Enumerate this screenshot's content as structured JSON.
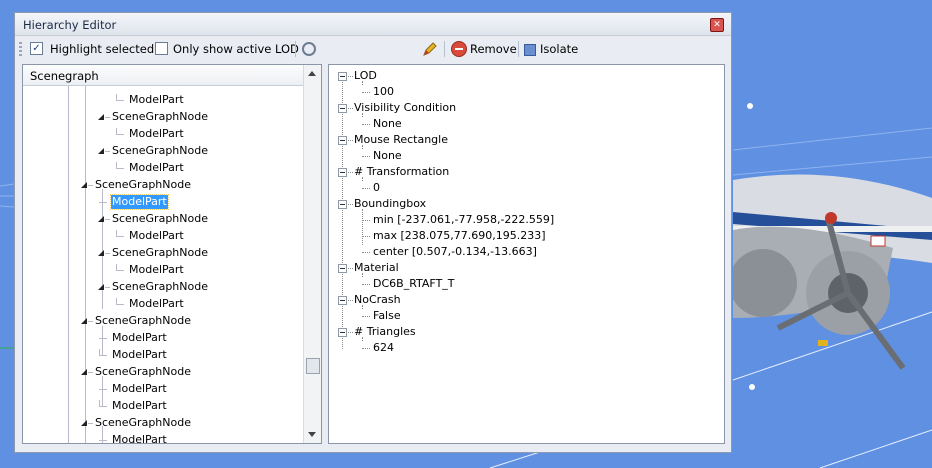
{
  "window": {
    "title": "Hierarchy Editor"
  },
  "toolbar": {
    "highlight_label": "Highlight selected",
    "highlight_checked": true,
    "lod_label": "Only show active LOD",
    "lod_checked": false,
    "remove_label": "Remove",
    "isolate_label": "Isolate"
  },
  "scenegraph": {
    "header": "Scenegraph",
    "rows": [
      "ModelPart",
      "SceneGraphNode",
      "ModelPart",
      "SceneGraphNode",
      "ModelPart",
      "SceneGraphNode",
      "ModelPart",
      "SceneGraphNode",
      "ModelPart",
      "SceneGraphNode",
      "ModelPart",
      "SceneGraphNode",
      "ModelPart",
      "SceneGraphNode",
      "ModelPart",
      "ModelPart",
      "SceneGraphNode",
      "ModelPart",
      "ModelPart",
      "SceneGraphNode",
      "ModelPart"
    ],
    "selected_index": 6
  },
  "properties": [
    {
      "name": "LOD",
      "values": [
        "100"
      ]
    },
    {
      "name": "Visibility Condition",
      "values": [
        "None"
      ]
    },
    {
      "name": "Mouse Rectangle",
      "values": [
        "None"
      ]
    },
    {
      "name": "# Transformation",
      "values": [
        "0"
      ]
    },
    {
      "name": "Boundingbox",
      "values": [
        "min [-237.061,-77.958,-222.559]",
        "max [238.075,77.690,195.233]",
        "center [0.507,-0.134,-13.663]"
      ]
    },
    {
      "name": "Material",
      "values": [
        "DC6B_RTAFT_T"
      ]
    },
    {
      "name": "NoCrash",
      "values": [
        "False"
      ]
    },
    {
      "name": "# Triangles",
      "values": [
        "624"
      ]
    }
  ],
  "colors": {
    "viewport": "#5f90e2",
    "selection": "#3399ff"
  }
}
